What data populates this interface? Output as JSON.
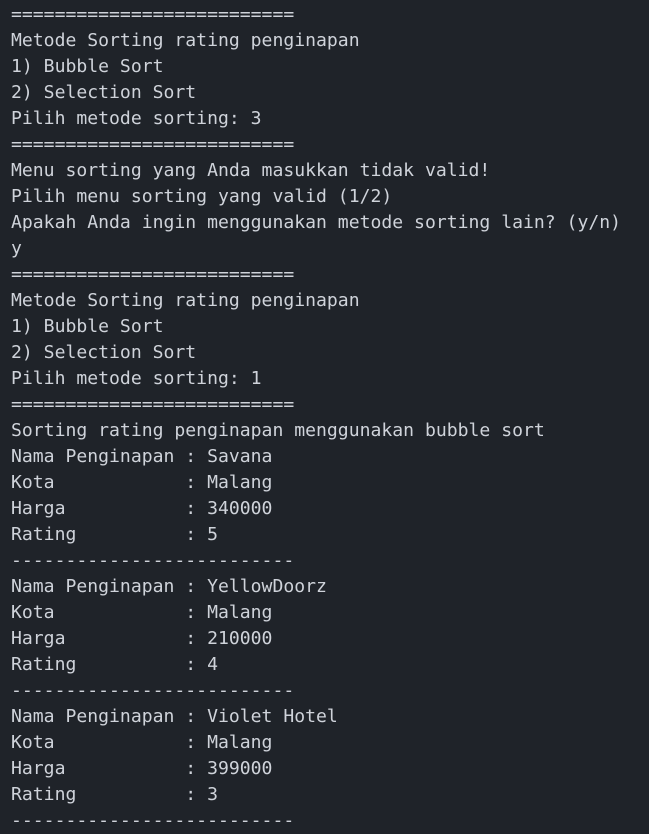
{
  "console": {
    "lines": [
      "==========================",
      "Metode Sorting rating penginapan",
      "1) Bubble Sort",
      "2) Selection Sort",
      "Pilih metode sorting: 3",
      "==========================",
      "Menu sorting yang Anda masukkan tidak valid!",
      "Pilih menu sorting yang valid (1/2)",
      "Apakah Anda ingin menggunakan metode sorting lain? (y/n)",
      "y",
      "==========================",
      "Metode Sorting rating penginapan",
      "1) Bubble Sort",
      "2) Selection Sort",
      "Pilih metode sorting: 1",
      "==========================",
      "Sorting rating penginapan menggunakan bubble sort",
      "Nama Penginapan : Savana",
      "Kota            : Malang",
      "Harga           : 340000",
      "Rating          : 5",
      "--------------------------",
      "Nama Penginapan : YellowDoorz",
      "Kota            : Malang",
      "Harga           : 210000",
      "Rating          : 4",
      "--------------------------",
      "Nama Penginapan : Violet Hotel",
      "Kota            : Malang",
      "Harga           : 399000",
      "Rating          : 3",
      "--------------------------"
    ]
  },
  "colors": {
    "background": "#1f2329",
    "text": "#cfd3da"
  }
}
